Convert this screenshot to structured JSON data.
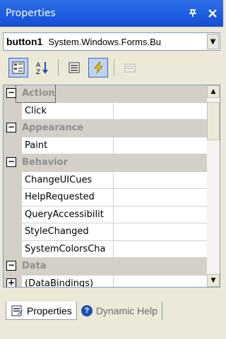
{
  "window": {
    "title": "Properties",
    "pin_glyph": "p",
    "close_glyph": "✕"
  },
  "object_selector": {
    "name": "button1",
    "type": "System.Windows.Forms.Bu"
  },
  "toolbar": {
    "buttons": [
      {
        "icon": "categorized-icon",
        "pressed": true
      },
      {
        "icon": "alphabetical-icon",
        "pressed": false
      },
      {
        "icon": "properties-icon",
        "pressed": false
      },
      {
        "icon": "events-icon",
        "pressed": true
      },
      {
        "icon": "property-pages-icon",
        "pressed": false,
        "disabled": true
      }
    ]
  },
  "grid": {
    "rows": [
      {
        "kind": "category",
        "label": "Action",
        "expanded": true
      },
      {
        "kind": "item",
        "label": "Click"
      },
      {
        "kind": "category",
        "label": "Appearance",
        "expanded": true
      },
      {
        "kind": "item",
        "label": "Paint"
      },
      {
        "kind": "category",
        "label": "Behavior",
        "expanded": true
      },
      {
        "kind": "item",
        "label": "ChangeUICues"
      },
      {
        "kind": "item",
        "label": "HelpRequested"
      },
      {
        "kind": "item",
        "label": "QueryAccessibilit"
      },
      {
        "kind": "item",
        "label": "StyleChanged"
      },
      {
        "kind": "item",
        "label": "SystemColorsCha"
      },
      {
        "kind": "category",
        "label": "Data",
        "expanded": true
      },
      {
        "kind": "item",
        "label": "(DataBindings)",
        "collapsible": true
      }
    ]
  },
  "tabs": [
    {
      "label": "Properties",
      "active": true
    },
    {
      "label": "Dynamic Help",
      "active": false
    }
  ],
  "colors": {
    "titlebar": "#1c5be0",
    "category_bg": "#d4d0c8",
    "category_text": "#8e8e8e"
  }
}
